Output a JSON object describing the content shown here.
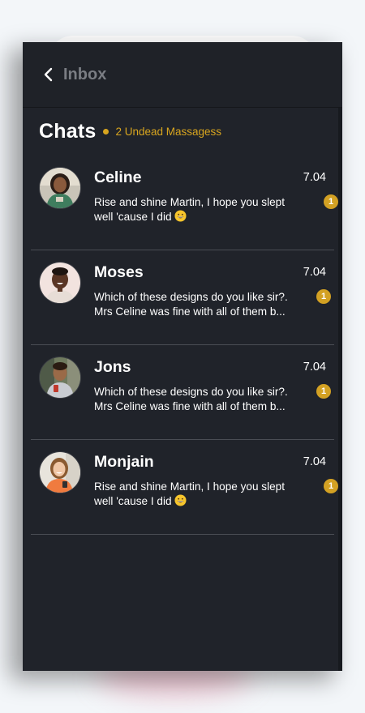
{
  "header": {
    "back_icon": "chevron-left-icon",
    "title": "Inbox"
  },
  "page": {
    "title": "Chats",
    "unread_label": "2 Undead Massagess",
    "accent_color": "#d8a51f",
    "background_color": "#20232a"
  },
  "chats": [
    {
      "name": "Celine",
      "time": "7.04",
      "line1": "Rise and shine Martin, I hope you slept",
      "line2": "well 'cause I did",
      "emoji": "grinning-face-icon",
      "badge": "1"
    },
    {
      "name": "Moses",
      "time": "7.04",
      "line1": "Which of these designs do you like sir?.",
      "line2": "Mrs Celine was fine with all of them b...",
      "emoji": "",
      "badge": "1"
    },
    {
      "name": "Jons",
      "time": "7.04",
      "line1": "Which of these designs do you like sir?.",
      "line2": "Mrs Celine was fine with all of them b...",
      "emoji": "",
      "badge": "1"
    },
    {
      "name": "Monjain",
      "time": "7.04",
      "line1": "Rise and shine Martin, I hope you slept",
      "line2": "well 'cause I did",
      "emoji": "grinning-face-icon",
      "badge": "1"
    }
  ]
}
